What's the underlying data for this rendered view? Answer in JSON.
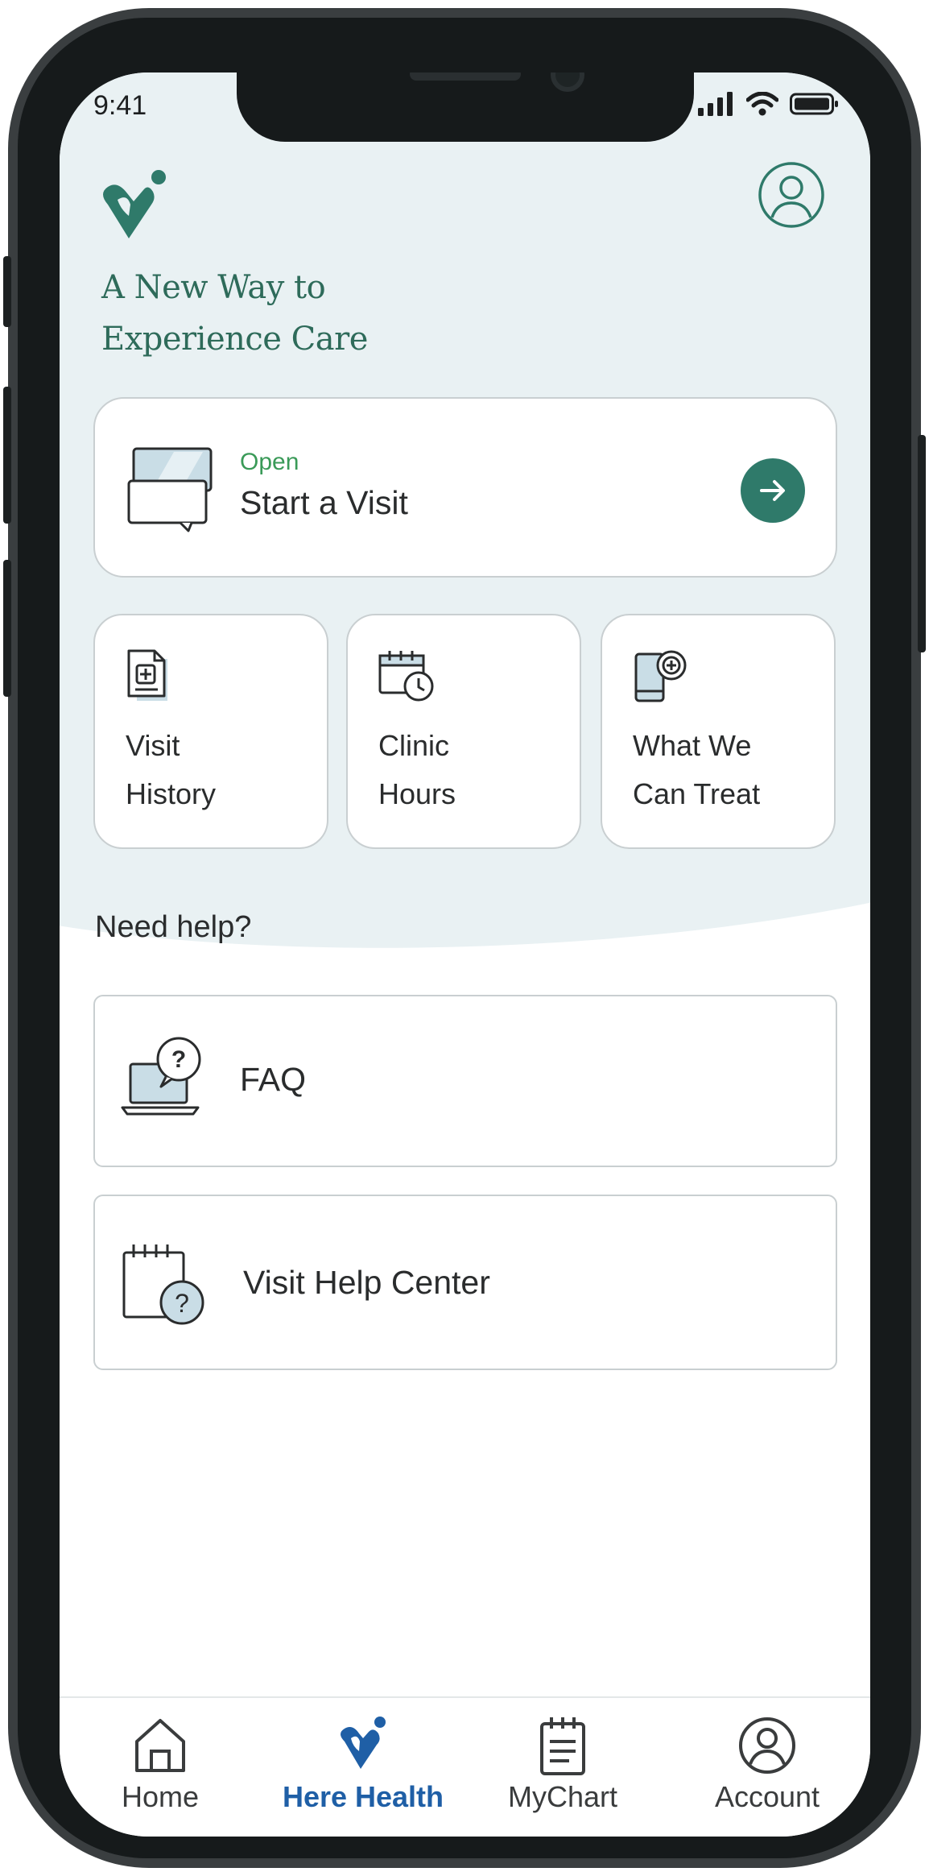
{
  "status_bar": {
    "time": "9:41"
  },
  "header": {
    "tagline_line1": "A New Way to",
    "tagline_line2": "Experience Care"
  },
  "visit_card": {
    "status": "Open",
    "title": "Start a Visit"
  },
  "quick_tiles": [
    {
      "line1": "Visit",
      "line2": "History"
    },
    {
      "line1": "Clinic",
      "line2": "Hours"
    },
    {
      "line1": "What We",
      "line2": "Can Treat"
    }
  ],
  "help": {
    "heading": "Need help?",
    "faq_label": "FAQ",
    "help_center_label": "Visit Help Center"
  },
  "tabbar": {
    "items": [
      {
        "label": "Home",
        "icon": "home-icon"
      },
      {
        "label": "Here Health",
        "icon": "heart-logo-icon",
        "active": true
      },
      {
        "label": "MyChart",
        "icon": "clipboard-icon"
      },
      {
        "label": "Account",
        "icon": "account-icon"
      }
    ]
  },
  "colors": {
    "brand_green": "#2f7a6a",
    "open_green": "#3a9a58",
    "active_tab_blue": "#1f5fa6",
    "hero_bg": "#e9f1f3"
  }
}
